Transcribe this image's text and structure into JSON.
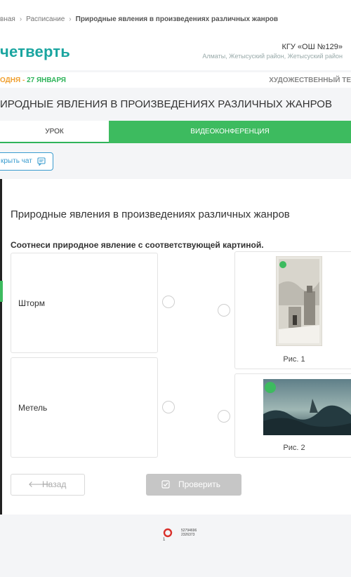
{
  "breadcrumb": {
    "home": "вная",
    "schedule": "Расписание",
    "current": "Природные явления в произведениях различных жанров"
  },
  "header": {
    "logo": "четверть",
    "school_name": "КГУ «ОШ №129»",
    "school_address": "Алматы, Жетысуский район, Жетысуский район"
  },
  "datebar": {
    "today_label": "ОДНЯ - ",
    "today_date": "27 ЯНВАРЯ",
    "subject": "ХУДОЖЕСТВЕННЫЙ ТЕ"
  },
  "lesson_title": "ИРОДНЫЕ ЯВЛЕНИЯ В ПРОИЗВЕДЕНИЯХ РАЗЛИЧНЫХ ЖАНРОВ",
  "tabs": {
    "lesson": "УРОК",
    "video": "ВИДЕОКОНФЕРЕНЦИЯ"
  },
  "chat_button": "крыть чат",
  "task": {
    "title": "Природные явления в произведениях различных жанров",
    "instruction": "Соотнеси природное явление с соответствующей картиной.",
    "terms": [
      "Шторм",
      "Метель"
    ],
    "pictures": [
      {
        "caption": "Рис. 1",
        "icon": "winter-town-painting"
      },
      {
        "caption": "Рис. 2",
        "icon": "stormy-sea-painting"
      }
    ]
  },
  "buttons": {
    "back": "Назад",
    "check": "Проверить"
  },
  "footer": {
    "digits_line1": "52794696",
    "digits_line2": "2326373",
    "sub": "1"
  },
  "colors": {
    "accent_green": "#3dbb5f",
    "logo_teal": "#1aa5a0",
    "link_blue": "#3a9ccf",
    "date_orange": "#f0a030"
  }
}
